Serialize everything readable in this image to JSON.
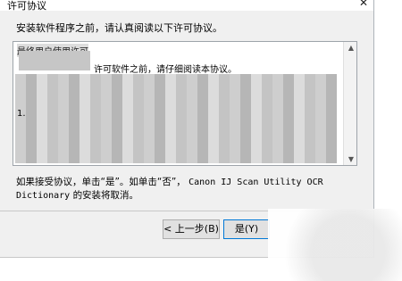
{
  "window": {
    "title": "许可协议",
    "close_glyph": "✕"
  },
  "instruction": "安装软件程序之前，请认真阅读以下许可协议。",
  "license": {
    "heading": "最终用户使用许可",
    "line": "许可软件之前，请仔细阅读本协议。",
    "number_fragment": "1.",
    "scroll_up": "▲",
    "scroll_down": "▼"
  },
  "question": {
    "text_part1": "如果接受协议，单击“是”。如单击“否”，",
    "product": "Canon IJ Scan Utility OCR Dictionary",
    "text_part2": "的安装将取消。"
  },
  "buttons": {
    "back": "< 上一步(B)",
    "yes": "是(Y)"
  }
}
